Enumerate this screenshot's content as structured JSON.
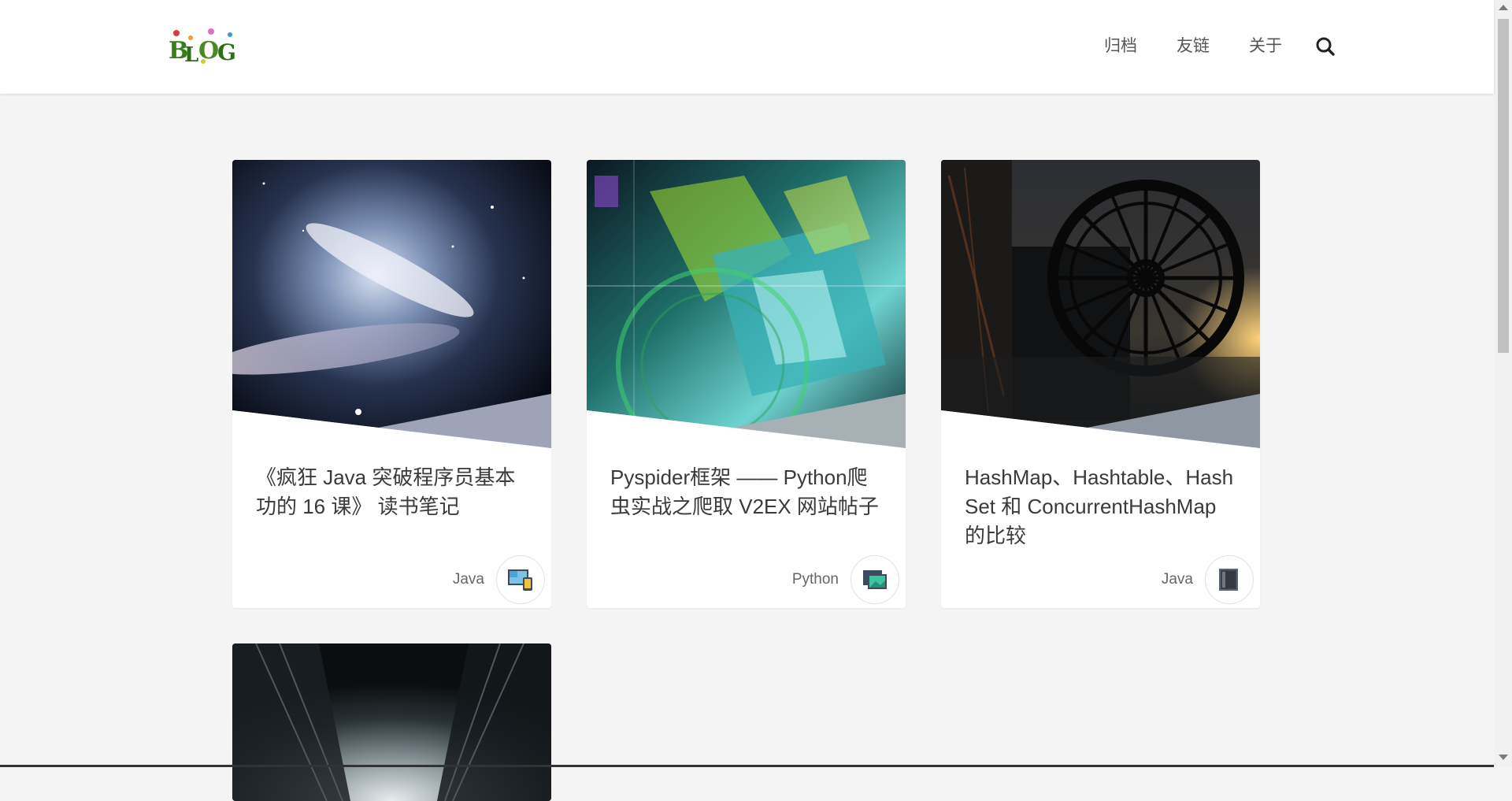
{
  "header": {
    "logo_text": "BLOG",
    "nav": [
      "归档",
      "友链",
      "关于"
    ],
    "search_icon": "search-icon"
  },
  "posts": [
    {
      "title": "《疯狂 Java 突破程序员基本功的 16 课》 读书笔记",
      "category": "Java",
      "icon": "devices-icon"
    },
    {
      "title": "Pyspider框架 —— Python爬虫实战之爬取 V2EX 网站帖子",
      "category": "Python",
      "icon": "monitor-icon"
    },
    {
      "title": "HashMap、Hashtable、HashSet 和 ConcurrentHashMap 的比较",
      "category": "Java",
      "icon": "tablet-icon"
    }
  ],
  "colors": {
    "background": "#f4f4f4",
    "header": "#ffffff",
    "card": "#ffffff",
    "text": "#3a3a3a"
  }
}
